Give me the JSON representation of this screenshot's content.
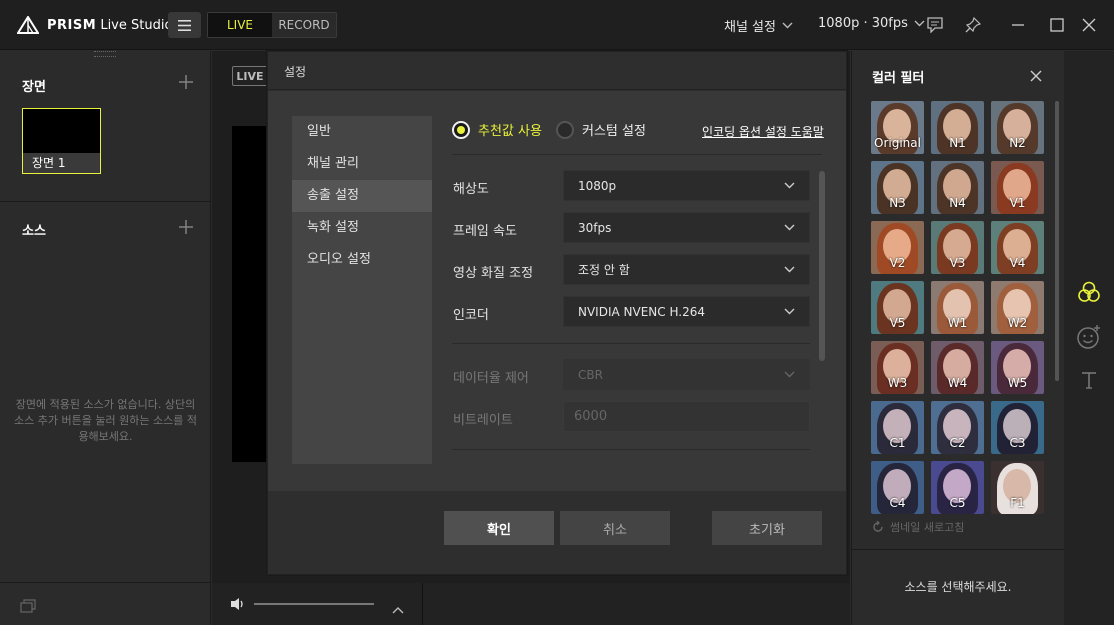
{
  "app": {
    "name_bold": "PRISM",
    "name_rest": "Live Studio",
    "mode_live": "LIVE",
    "mode_record": "RECORD",
    "channel_settings": "채널 설정",
    "output_preset": "1080p · 30fps"
  },
  "left": {
    "scene_title": "장면",
    "scene_name": "장면 1",
    "source_title": "소스",
    "empty_message": "장면에 적용된 소스가 없습니다. 상단의 소스 추가 버튼을 눌러 원하는 소스를 적용해보세요."
  },
  "center": {
    "live_badge": "LIVE"
  },
  "dialog": {
    "title": "설정",
    "nav": [
      "일반",
      "채널 관리",
      "송출 설정",
      "녹화 설정",
      "오디오 설정"
    ],
    "active_nav": "송출 설정",
    "radio_recommended": "추천값 사용",
    "radio_custom": "커스텀 설정",
    "help_link": "인코딩 옵션 설정 도움말",
    "fields": {
      "resolution_label": "해상도",
      "resolution_value": "1080p",
      "fps_label": "프레임 속도",
      "fps_value": "30fps",
      "quality_label": "영상 화질 조정",
      "quality_value": "조정 안 함",
      "encoder_label": "인코더",
      "encoder_value": "NVIDIA NVENC H.264",
      "ratecontrol_label": "데이터율 제어",
      "ratecontrol_value": "CBR",
      "bitrate_label": "비트레이트",
      "bitrate_value": "6000"
    },
    "btn_ok": "확인",
    "btn_cancel": "취소",
    "btn_reset": "초기화"
  },
  "right": {
    "title": "컬러 필터",
    "filters": [
      "Original",
      "N1",
      "N2",
      "N3",
      "N4",
      "V1",
      "V2",
      "V3",
      "V4",
      "V5",
      "W1",
      "W2",
      "W3",
      "W4",
      "W5",
      "C1",
      "C2",
      "C3",
      "C4",
      "C5",
      "F1"
    ],
    "refresh_label": "썸네일 새로고침",
    "select_source": "소스를 선택해주세요."
  },
  "colors": {
    "accent": "#e9f23a"
  }
}
